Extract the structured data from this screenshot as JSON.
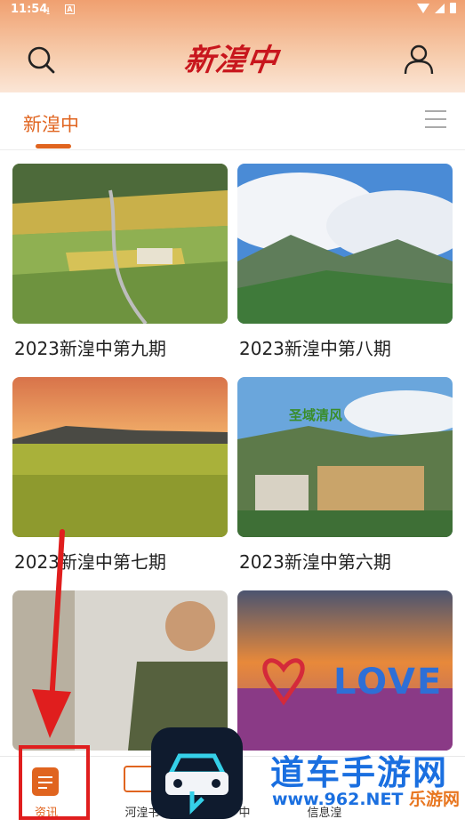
{
  "status_bar": {
    "time": "11:54"
  },
  "header": {
    "logo_text": "新湟中"
  },
  "tabs": [
    {
      "label": "新湟中",
      "active": true
    }
  ],
  "cards": [
    {
      "title": "2023新湟中第九期"
    },
    {
      "title": "2023新湟中第八期"
    },
    {
      "title": "2023新湟中第七期"
    },
    {
      "title": "2023新湟中第六期"
    },
    {
      "title": ""
    },
    {
      "title": ""
    }
  ],
  "card_overlays": {
    "card6_love_text": "LOVE",
    "card4_overlay_text": "圣域清风"
  },
  "bottom_nav": [
    {
      "label": "资讯",
      "active": true
    },
    {
      "label": "河湟书"
    },
    {
      "label": "中"
    },
    {
      "label": "信息湟"
    }
  ],
  "watermark": {
    "title": "道车手游网",
    "domain": "www.962.NET",
    "sub": "乐游网"
  },
  "colors": {
    "accent": "#e0641f",
    "logo": "#c8161d",
    "highlight": "#e01e1e"
  }
}
